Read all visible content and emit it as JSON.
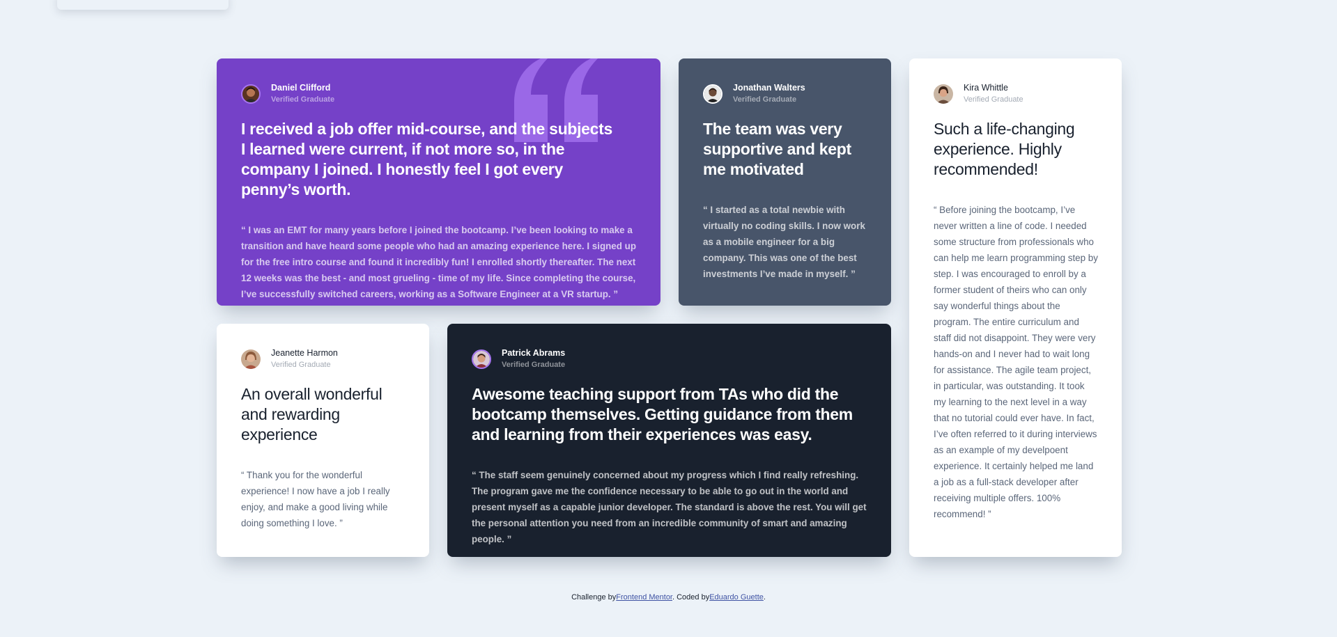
{
  "cards": [
    {
      "name": "Daniel Clifford",
      "role": "Verified Graduate",
      "title": "I received a job offer mid-course, and the subjects I learned were current, if not more so, in the company I joined. I honestly feel I got every penny’s worth.",
      "body": "“ I was an EMT for many years before I joined the bootcamp. I’ve been looking to make a transition and have heard some people who had an amazing experience here. I signed up for the free intro course and found it incredibly fun! I enrolled shortly thereafter. The next 12 weeks was the best - and most grueling - time of my life. Since completing the course, I’ve successfully switched careers, working as a Software Engineer at a VR startup. ”",
      "bg": "#7541c8"
    },
    {
      "name": "Jonathan Walters",
      "role": "Verified Graduate",
      "title": "The team was very supportive and kept me motivated",
      "body": "“ I started as a total newbie with virtually no coding skills. I now work as a mobile engineer for a big company. This was one of the best investments I’ve made in myself. ”",
      "bg": "#48556a"
    },
    {
      "name": "Kira Whittle",
      "role": "Verified Graduate",
      "title": "Such a life-changing experience. Highly recommended!",
      "body": "“ Before joining the bootcamp, I’ve never written a line of code. I needed some structure from professionals who can help me learn programming step by step. I was encouraged to enroll by a former student of theirs who can only say wonderful things about the program. The entire curriculum and staff did not disappoint. They were very hands-on and I never had to wait long for assistance. The agile team project, in particular, was outstanding. It took my learning to the next level in a way that no tutorial could ever have. In fact, I’ve often referred to it during interviews as an example of my develpoent experience. It certainly helped me land a job as a full-stack developer after receiving multiple offers. 100% recommend! ”",
      "bg": "#ffffff"
    },
    {
      "name": "Jeanette Harmon",
      "role": "Verified Graduate",
      "title": "An overall wonderful and rewarding experience",
      "body": "“ Thank you for the wonderful experience! I now have a job I really enjoy, and make a good living while doing something I love. ”",
      "bg": "#ffffff"
    },
    {
      "name": "Patrick Abrams",
      "role": "Verified Graduate",
      "title": "Awesome teaching support from TAs who did the bootcamp themselves. Getting guidance from them and learning from their experiences was easy.",
      "body": "“ The staff seem genuinely concerned about my progress which I find really refreshing. The program gave me the confidence necessary to be able to go out in the world and present myself as a capable junior developer. The standard is above the rest. You will get the personal attention you need from an incredible community of smart and amazing people. ”",
      "bg": "#19212e"
    }
  ],
  "footer": {
    "prefix": "Challenge by",
    "link1": "Frontend Mentor",
    "middle": ". Coded by",
    "link2": "Eduardo Guette",
    "suffix": "."
  },
  "colors": {
    "page_bg": "#ecf2f8",
    "purple": "#7541c8",
    "grey_blue": "#48556a",
    "blackish": "#19212e",
    "quote_mark": "#a775f1"
  }
}
